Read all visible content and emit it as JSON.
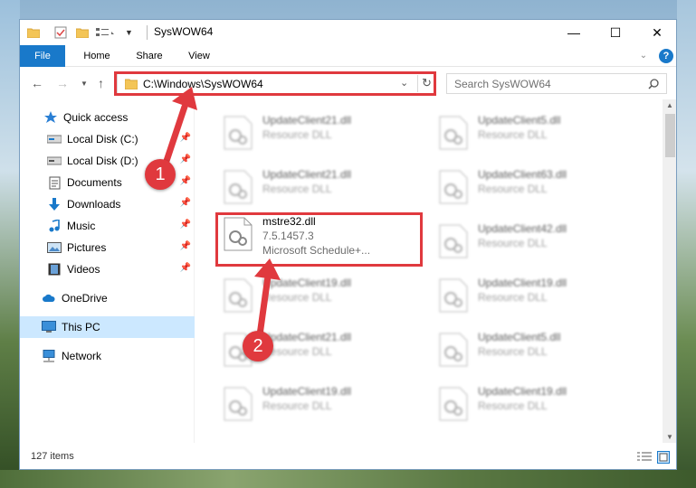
{
  "window": {
    "title": "SysWOW64",
    "controls": {
      "minimize": "—",
      "maximize": "☐",
      "close": "✕"
    }
  },
  "ribbon": {
    "tabs": [
      {
        "label": "File",
        "active": true
      },
      {
        "label": "Home"
      },
      {
        "label": "Share"
      },
      {
        "label": "View"
      }
    ],
    "help": "?"
  },
  "address": {
    "path": "C:\\Windows\\SysWOW64",
    "search_placeholder": "Search SysWOW64"
  },
  "sidebar": {
    "items": [
      {
        "label": "Quick access",
        "icon": "star-icon"
      },
      {
        "label": "Local Disk (C:)",
        "icon": "drive-icon",
        "pinned": true
      },
      {
        "label": "Local Disk (D:)",
        "icon": "drive-icon",
        "pinned": true
      },
      {
        "label": "Documents",
        "icon": "documents-icon",
        "pinned": true
      },
      {
        "label": "Downloads",
        "icon": "downloads-icon",
        "pinned": true
      },
      {
        "label": "Music",
        "icon": "music-icon",
        "pinned": true
      },
      {
        "label": "Pictures",
        "icon": "pictures-icon",
        "pinned": true
      },
      {
        "label": "Videos",
        "icon": "videos-icon",
        "pinned": true
      },
      {
        "label": "OneDrive",
        "icon": "cloud-icon"
      },
      {
        "label": "This PC",
        "icon": "computer-icon",
        "selected": true
      },
      {
        "label": "Network",
        "icon": "network-icon"
      }
    ]
  },
  "files": {
    "left": [
      {
        "name": "UpdateClient21.dll",
        "type": "Resource DLL"
      },
      {
        "name": "UpdateClient21.dll",
        "type": "Resource DLL"
      },
      {
        "name": "mstre32.dll",
        "version": "7.5.1457.3",
        "type": "Microsoft Schedule+..."
      },
      {
        "name": "UpdateClient19.dll",
        "type": "Resource DLL"
      },
      {
        "name": "UpdateClient21.dll",
        "type": "Resource DLL"
      },
      {
        "name": "UpdateClient19.dll",
        "type": "Resource DLL"
      }
    ],
    "right": [
      {
        "name": "UpdateClient5.dll",
        "type": "Resource DLL"
      },
      {
        "name": "UpdateClient63.dll",
        "type": "Resource DLL"
      },
      {
        "name": "UpdateClient42.dll",
        "type": "Resource DLL"
      },
      {
        "name": "UpdateClient19.dll",
        "type": "Resource DLL"
      },
      {
        "name": "UpdateClient5.dll",
        "type": "Resource DLL"
      },
      {
        "name": "UpdateClient19.dll",
        "type": "Resource DLL"
      }
    ]
  },
  "status": {
    "item_count": "127 items"
  },
  "annotations": {
    "step1": "1",
    "step2": "2"
  },
  "colors": {
    "accent": "#1979ca",
    "annotation": "#e0393e",
    "selected": "#cce8ff"
  }
}
